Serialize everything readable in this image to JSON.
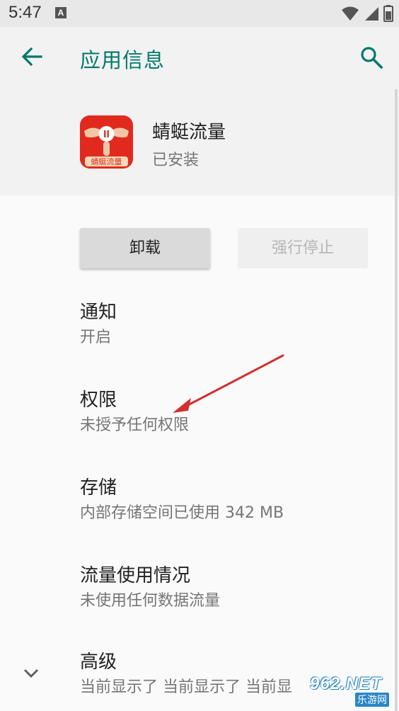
{
  "status_bar": {
    "time": "5:47",
    "notification_letter": "A"
  },
  "app_bar": {
    "title": "应用信息"
  },
  "app": {
    "name": "蜻蜓流量",
    "status": "已安装",
    "icon_label": "蜻蜓流量"
  },
  "buttons": {
    "uninstall": "卸载",
    "force_stop": "强行停止"
  },
  "items": [
    {
      "title": "通知",
      "subtitle": "开启"
    },
    {
      "title": "权限",
      "subtitle": "未授予任何权限"
    },
    {
      "title": "存储",
      "subtitle": "内部存储空间已使用 342 MB"
    },
    {
      "title": "流量使用情况",
      "subtitle": "未使用任何数据流量"
    },
    {
      "title": "高级",
      "subtitle": "当前显示了 当前显示了 当前显"
    }
  ],
  "watermark": {
    "text": "962.NET",
    "sub": "乐游网"
  },
  "colors": {
    "accent": "#00796b",
    "app_icon_bg": "#e12a1d",
    "annotation_arrow": "#d32f2f"
  }
}
